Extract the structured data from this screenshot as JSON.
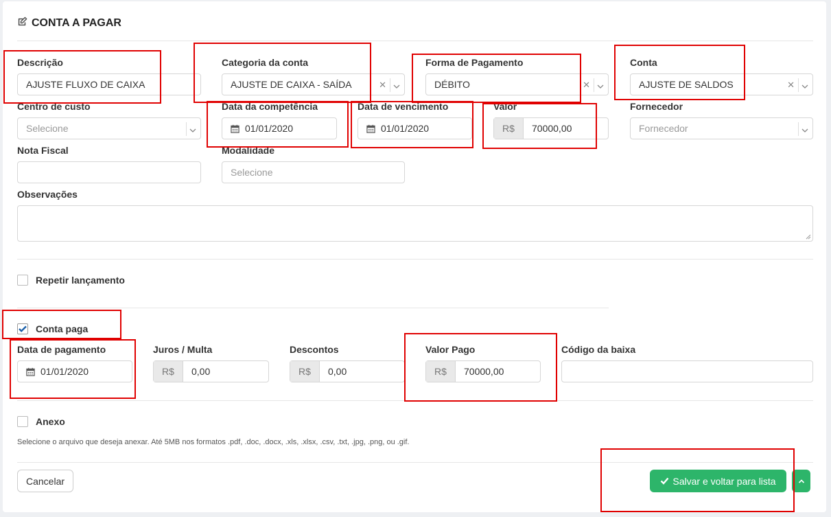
{
  "page": {
    "title": "CONTA A PAGAR",
    "title_icon": "edit-icon"
  },
  "fields": {
    "descricao": {
      "label": "Descrição",
      "value": "AJUSTE FLUXO DE CAIXA"
    },
    "categoria": {
      "label": "Categoria da conta",
      "value": "AJUSTE DE CAIXA - SAÍDA"
    },
    "forma_pagamento": {
      "label": "Forma de Pagamento",
      "value": "DÉBITO"
    },
    "conta": {
      "label": "Conta",
      "value": "AJUSTE DE SALDOS"
    },
    "centro_custo": {
      "label": "Centro de custo",
      "placeholder": "Selecione"
    },
    "data_competencia": {
      "label": "Data da competência",
      "value": "01/01/2020"
    },
    "data_vencimento": {
      "label": "Data de vencimento",
      "value": "01/01/2020"
    },
    "valor": {
      "label": "Valor",
      "prefix": "R$",
      "value": "70000,00"
    },
    "fornecedor": {
      "label": "Fornecedor",
      "placeholder": "Fornecedor"
    },
    "nota_fiscal": {
      "label": "Nota Fiscal",
      "value": ""
    },
    "modalidade": {
      "label": "Modalidade",
      "placeholder": "Selecione"
    },
    "observacoes": {
      "label": "Observações",
      "value": ""
    }
  },
  "repetir": {
    "label": "Repetir lançamento",
    "checked": false
  },
  "conta_paga": {
    "label": "Conta paga",
    "checked": true
  },
  "pagamento": {
    "data_pagamento": {
      "label": "Data de pagamento",
      "value": "01/01/2020"
    },
    "juros": {
      "label": "Juros / Multa",
      "prefix": "R$",
      "value": "0,00"
    },
    "descontos": {
      "label": "Descontos",
      "prefix": "R$",
      "value": "0,00"
    },
    "valor_pago": {
      "label": "Valor Pago",
      "prefix": "R$",
      "value": "70000,00"
    },
    "codigo_baixa": {
      "label": "Código da baixa",
      "value": ""
    }
  },
  "anexo": {
    "label": "Anexo",
    "checked": false,
    "hint": "Selecione o arquivo que deseja anexar. Até 5MB nos formatos .pdf, .doc, .docx, .xls, .xlsx, .csv, .txt, .jpg, .png, ou .gif."
  },
  "buttons": {
    "cancel": "Cancelar",
    "save": "Salvar e voltar para lista"
  },
  "colors": {
    "accent_green": "#2db56a",
    "highlight_red": "#e00000",
    "checkbox_blue": "#1a5fa8"
  }
}
